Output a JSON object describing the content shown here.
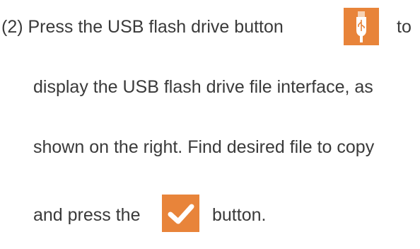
{
  "instruction": {
    "line1_text": "(2) Press the USB flash drive button",
    "line1_after": "to",
    "line2_text": "display the USB flash drive file interface, as",
    "line3_text": "shown on the right. Find desired file to copy",
    "line4_before": "and press the",
    "line4_after": "button."
  },
  "icons": {
    "usb_button": {
      "name": "usb-flash-drive-icon",
      "color": "#e8843a"
    },
    "confirm_button": {
      "name": "checkmark-icon",
      "color": "#e8843a"
    }
  }
}
